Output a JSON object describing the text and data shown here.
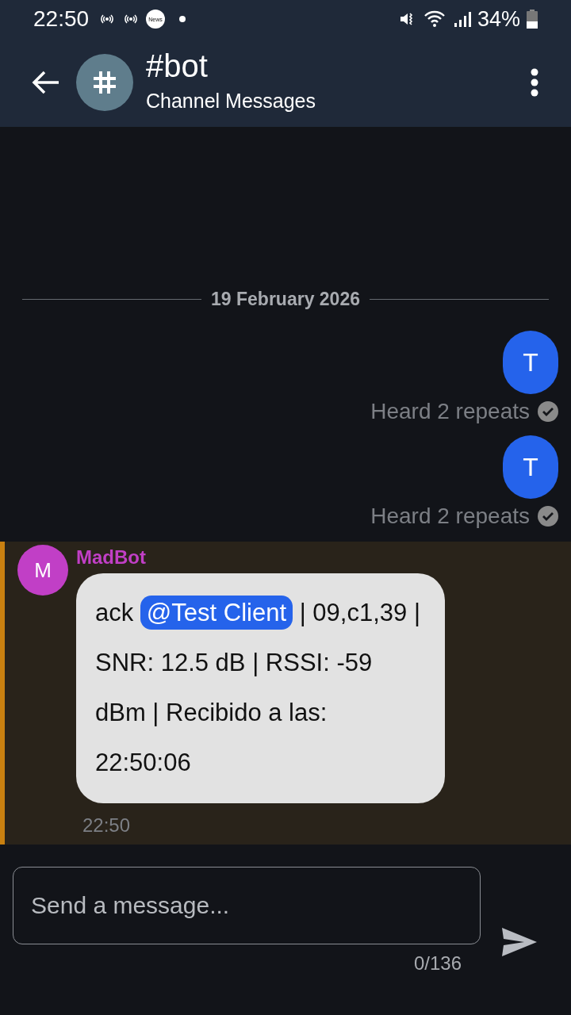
{
  "status_bar": {
    "time": "22:50",
    "news_badge": "News",
    "battery": "34%"
  },
  "header": {
    "title": "#bot",
    "subtitle": "Channel Messages"
  },
  "date_divider": "19 February 2026",
  "outgoing": [
    {
      "text": "T",
      "status": "Heard 2 repeats",
      "acknowledged": true
    },
    {
      "text": "T",
      "status": "Heard 2 repeats",
      "acknowledged": true
    }
  ],
  "incoming": {
    "sender": "MadBot",
    "avatar": "M",
    "color": "#c13fc6",
    "highlighted": true,
    "text_before": "ack",
    "mention": "@Test Client",
    "text_after": "| 09,c1,39 | SNR: 12.5 dB | RSSI: -59 dBm | Recibido a las: 22:50:06",
    "time": "22:50"
  },
  "composer": {
    "placeholder": "Send a message...",
    "counter": "0/136"
  }
}
